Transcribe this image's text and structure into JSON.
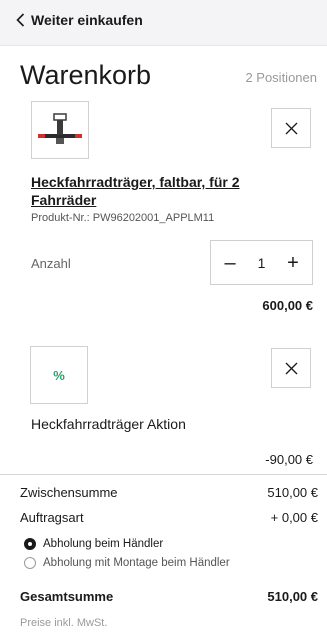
{
  "topbar": {
    "back_label": "Weiter einkaufen"
  },
  "cart": {
    "title": "Warenkorb",
    "count": "2 Positionen"
  },
  "items": [
    {
      "icon": "bike-carrier-product-image",
      "name": "Heckfahrradträger, faltbar, für 2 Fahrräder",
      "product_nr": "Produkt-Nr.: PW96202001_APPLM11",
      "qty_label": "Anzahl",
      "qty_minus": "–",
      "qty_value": "1",
      "qty_plus": "+",
      "price": "600,00 €"
    },
    {
      "icon": "percent-icon",
      "symbol": "%",
      "name": "Heckfahrradträger Aktion",
      "price": "-90,00 €"
    }
  ],
  "summary": {
    "subtotal_label": "Zwischensumme",
    "subtotal_value": "510,00 €",
    "order_type_label": "Auftragsart",
    "order_type_value": "+ 0,00 €",
    "options": [
      {
        "label": "Abholung beim Händler",
        "selected": true
      },
      {
        "label": "Abholung mit Montage beim Händler",
        "selected": false
      }
    ],
    "total_label": "Gesamtsumme",
    "total_value": "510,00 €",
    "footnote": "Preise inkl. MwSt."
  },
  "colors": {
    "accent": "#1a1a1a",
    "promo_green": "#2aa36b",
    "topbar_bg": "#f4f4f6"
  }
}
